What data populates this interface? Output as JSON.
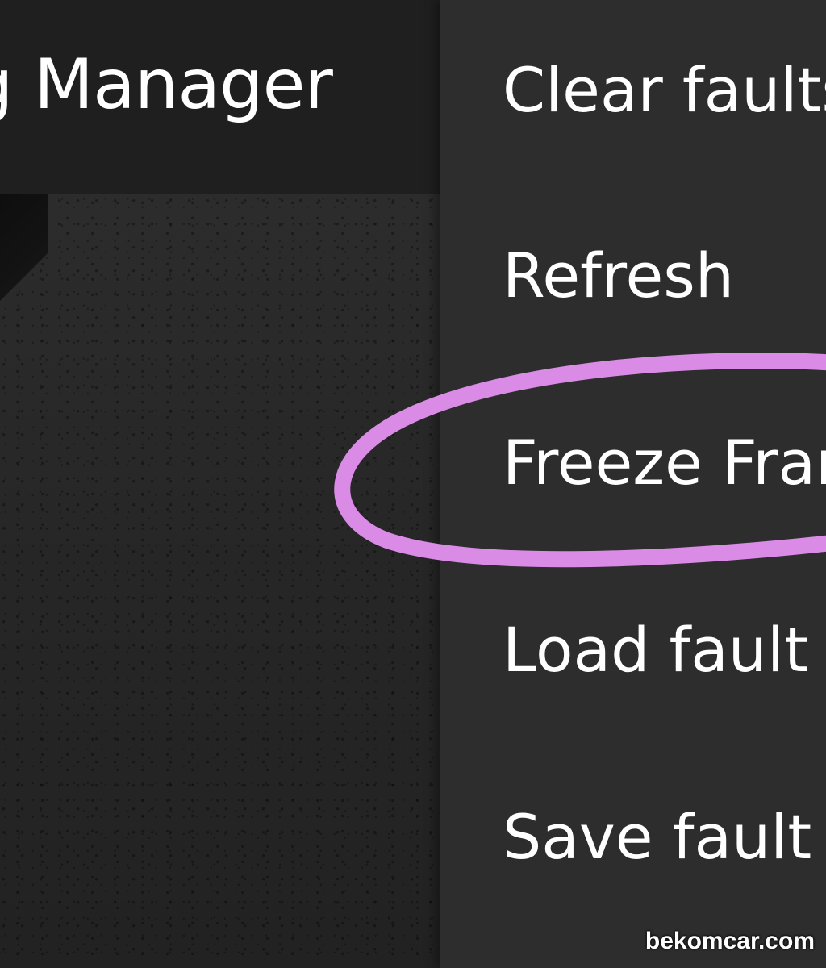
{
  "toolbar": {
    "title": "g Manager"
  },
  "menu": {
    "items": [
      {
        "label": "Clear faults"
      },
      {
        "label": "Refresh"
      },
      {
        "label": "Freeze Frame"
      },
      {
        "label": "Load fault log"
      },
      {
        "label": "Save fault log"
      }
    ]
  },
  "annotation": {
    "highlighted_item": "Freeze Frame",
    "color": "#d98be6"
  },
  "watermark": {
    "text": "bekomcar.com"
  },
  "colors": {
    "menu_background": "#2d2d2d",
    "toolbar_background": "#1f1f1f",
    "text": "#ffffff"
  }
}
